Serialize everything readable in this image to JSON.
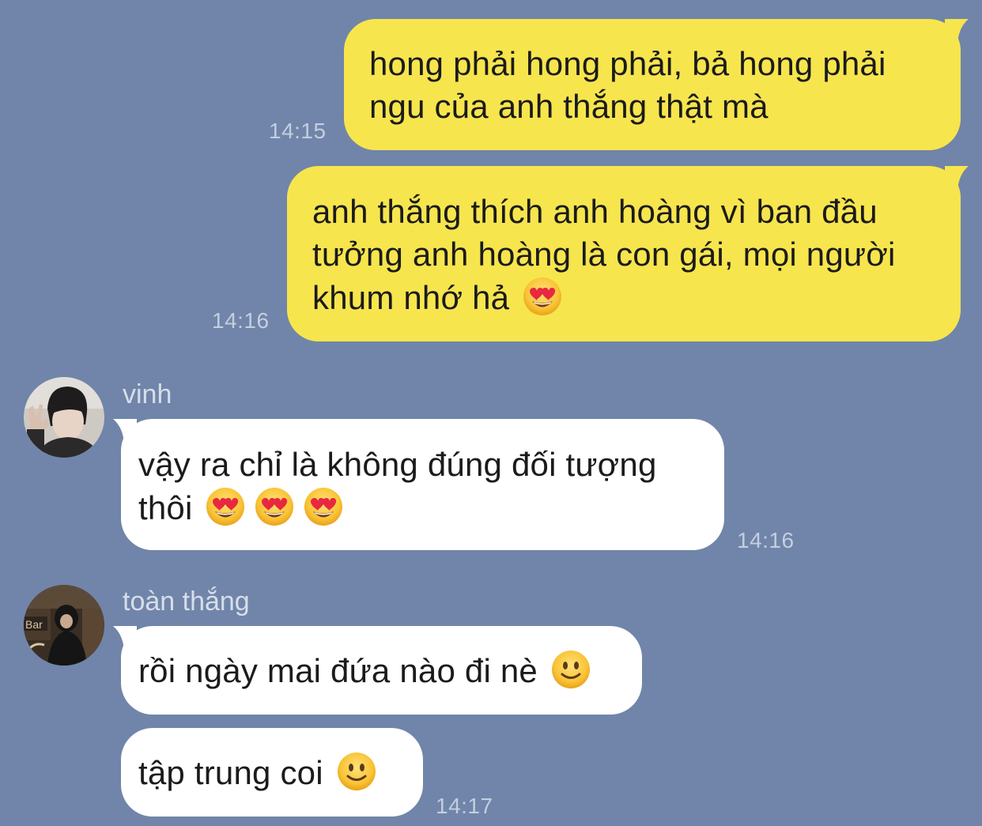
{
  "messages": [
    {
      "sender": "",
      "lines": [
        "hong phải hong phải, bả hong phải",
        "ngu của anh thắng thật mà"
      ],
      "time": "14:15"
    },
    {
      "sender": "",
      "lines": [
        "anh thắng thích anh hoàng vì ban đầu",
        "tưởng anh hoàng là con gái, mọi người",
        "khum nhớ hả"
      ],
      "emojis": [
        "heart-eyes"
      ],
      "time": "14:16"
    },
    {
      "sender": "vinh",
      "lines": [
        "vậy ra chỉ là không đúng đối tượng",
        "thôi"
      ],
      "emojis": [
        "heart-eyes",
        "heart-eyes",
        "heart-eyes"
      ],
      "time": "14:16"
    },
    {
      "sender": "toàn thắng",
      "lines": [
        "rồi ngày mai đứa nào đi nè"
      ],
      "emojis": [
        "slight-smile"
      ],
      "time": ""
    },
    {
      "sender": "",
      "lines": [
        "tập trung coi"
      ],
      "emojis": [
        "slight-smile"
      ],
      "time": "14:17"
    }
  ],
  "avatar_signage": "Bar",
  "colors": {
    "background": "#7085A9",
    "outgoing_bubble": "#F7E54E",
    "incoming_bubble": "#FFFFFF",
    "timestamp": "#C4CEDF",
    "sender_name": "#D7DEEA"
  }
}
